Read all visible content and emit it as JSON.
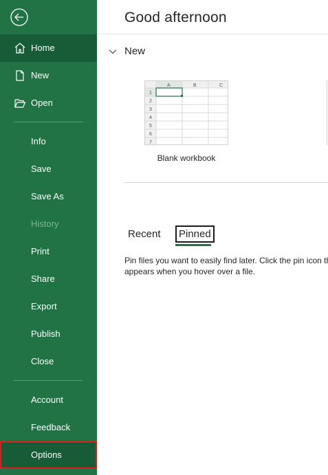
{
  "sidebar": {
    "back_icon": "back-arrow-icon",
    "items": [
      {
        "label": "Home",
        "icon": "home-icon"
      },
      {
        "label": "New",
        "icon": "new-document-icon"
      },
      {
        "label": "Open",
        "icon": "folder-open-icon"
      },
      {
        "label": "Info"
      },
      {
        "label": "Save"
      },
      {
        "label": "Save As"
      },
      {
        "label": "History"
      },
      {
        "label": "Print"
      },
      {
        "label": "Share"
      },
      {
        "label": "Export"
      },
      {
        "label": "Publish"
      },
      {
        "label": "Close"
      },
      {
        "label": "Account"
      },
      {
        "label": "Feedback"
      },
      {
        "label": "Options"
      }
    ]
  },
  "main": {
    "greeting": "Good afternoon",
    "new_section": {
      "title": "New",
      "templates": [
        {
          "caption": "Blank workbook",
          "columns": [
            "A",
            "B",
            "C"
          ],
          "rows": [
            "1",
            "2",
            "3",
            "4",
            "5",
            "6",
            "7"
          ]
        }
      ]
    },
    "tabs": [
      "Recent",
      "Pinned"
    ],
    "selected_tab": "Pinned",
    "pinned_description_line1": "Pin files you want to easily find later. Click the pin icon that",
    "pinned_description_line2": "appears when you hover over a file."
  },
  "colors": {
    "sidebar_bg": "#217346",
    "sidebar_active": "#185c37",
    "highlight_outline": "#e01b1b",
    "accent": "#217346"
  }
}
